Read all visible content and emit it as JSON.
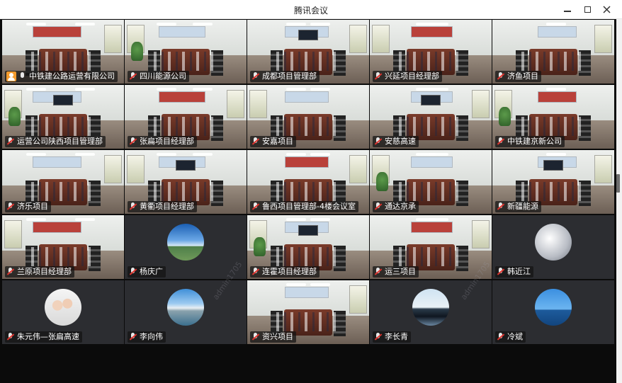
{
  "window": {
    "title": "腾讯会议"
  },
  "tiles": [
    {
      "name": "中铁建公路运营有限公司",
      "type": "room",
      "active": true,
      "host": true,
      "mic_on": true
    },
    {
      "name": "四川能源公司",
      "type": "room"
    },
    {
      "name": "成都项目管理部",
      "type": "room"
    },
    {
      "name": "兴延项目经理部",
      "type": "room"
    },
    {
      "name": "济鱼项目",
      "type": "room"
    },
    {
      "name": "运营公司陕西项目管理部",
      "type": "room"
    },
    {
      "name": "张扁项目经理部",
      "type": "room"
    },
    {
      "name": "安嘉项目",
      "type": "room"
    },
    {
      "name": "安慈高速",
      "type": "room"
    },
    {
      "name": "中铁建京新公司",
      "type": "room"
    },
    {
      "name": "济乐项目",
      "type": "room"
    },
    {
      "name": "黄衢项目经理部",
      "type": "room"
    },
    {
      "name": "鲁西项目管理部-4楼会议室",
      "type": "room"
    },
    {
      "name": "通达京承",
      "type": "room"
    },
    {
      "name": "新疆能源",
      "type": "room"
    },
    {
      "name": "兰原项目经理部",
      "type": "room"
    },
    {
      "name": "杨庆广",
      "type": "avatar",
      "avatar": "sky-icon"
    },
    {
      "name": "连霍项目经理部",
      "type": "room"
    },
    {
      "name": "运三项目",
      "type": "room"
    },
    {
      "name": "韩近江",
      "type": "avatar",
      "avatar": "ice-icon"
    },
    {
      "name": "朱元伟—张扁高速",
      "type": "avatar",
      "avatar": "family-photo-icon"
    },
    {
      "name": "李向伟",
      "type": "avatar",
      "avatar": "mountain-icon"
    },
    {
      "name": "资兴项目",
      "type": "room"
    },
    {
      "name": "李长青",
      "type": "avatar",
      "avatar": "rocks-icon"
    },
    {
      "name": "冷斌",
      "type": "avatar",
      "avatar": "sea-icon"
    }
  ],
  "colors": {
    "active_border": "#27c25f",
    "muted_mic": "#e0352f",
    "host_badge": "#f39a2c"
  }
}
